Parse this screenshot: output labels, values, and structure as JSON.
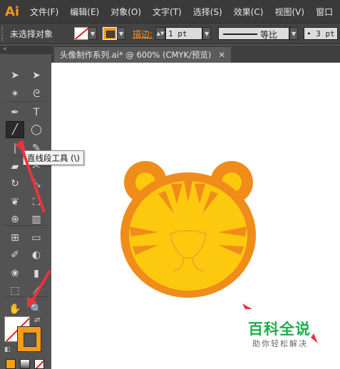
{
  "app": {
    "logo": "Ai"
  },
  "menu": [
    "文件(F)",
    "编辑(E)",
    "对象(O)",
    "文字(T)",
    "选择(S)",
    "效果(C)",
    "视图(V)",
    "窗口"
  ],
  "control": {
    "selection_label": "未选择对象",
    "stroke_label": "描边:",
    "stroke_weight": "1 pt",
    "line_style_label": "等比",
    "brush_value": "• 3 pt"
  },
  "document": {
    "tab_title": "头像制作系列.ai* @ 600% (CMYK/预览)",
    "close_icon": "close-icon"
  },
  "tooltip": {
    "text": "直线段工具 (\\)"
  },
  "tools": [
    {
      "name": "selection-tool",
      "glyph": "➤"
    },
    {
      "name": "direct-selection-tool",
      "glyph": "➤"
    },
    {
      "name": "magic-wand-tool",
      "glyph": "✶"
    },
    {
      "name": "lasso-tool",
      "glyph": "ᘓ"
    },
    {
      "name": "pen-tool",
      "glyph": "✒"
    },
    {
      "name": "type-tool",
      "glyph": "T"
    },
    {
      "name": "line-segment-tool",
      "glyph": "╱"
    },
    {
      "name": "ellipse-tool",
      "glyph": "◯"
    },
    {
      "name": "paintbrush-tool",
      "glyph": "❘"
    },
    {
      "name": "pencil-tool",
      "glyph": "✎"
    },
    {
      "name": "eraser-tool",
      "glyph": "▰"
    },
    {
      "name": "scissors-tool",
      "glyph": "✂"
    },
    {
      "name": "rotate-tool",
      "glyph": "↻"
    },
    {
      "name": "scale-tool",
      "glyph": "⤡"
    },
    {
      "name": "warp-tool",
      "glyph": "❦"
    },
    {
      "name": "free-transform-tool",
      "glyph": "⛶"
    },
    {
      "name": "shape-builder-tool",
      "glyph": "⊕"
    },
    {
      "name": "graph-tool",
      "glyph": "▥"
    },
    {
      "name": "mesh-tool",
      "glyph": "⊞"
    },
    {
      "name": "gradient-tool",
      "glyph": "▭"
    },
    {
      "name": "eyedropper-tool",
      "glyph": "✐"
    },
    {
      "name": "blend-tool",
      "glyph": "◐"
    },
    {
      "name": "symbol-sprayer-tool",
      "glyph": "❀"
    },
    {
      "name": "column-graph-tool",
      "glyph": "▮"
    },
    {
      "name": "artboard-tool",
      "glyph": "⬚"
    },
    {
      "name": "slice-tool",
      "glyph": "⟋"
    },
    {
      "name": "hand-tool",
      "glyph": "✋"
    },
    {
      "name": "zoom-tool",
      "glyph": "🔍"
    }
  ],
  "colors": {
    "accent": "#f7941d",
    "tiger_orange": "#f08c1a",
    "tiger_yellow": "#fdc90f",
    "annotation_red": "#e8343f",
    "watermark_green": "#1fae4a"
  },
  "watermark": {
    "title": "百科全说",
    "subtitle": "助你轻松解决"
  }
}
